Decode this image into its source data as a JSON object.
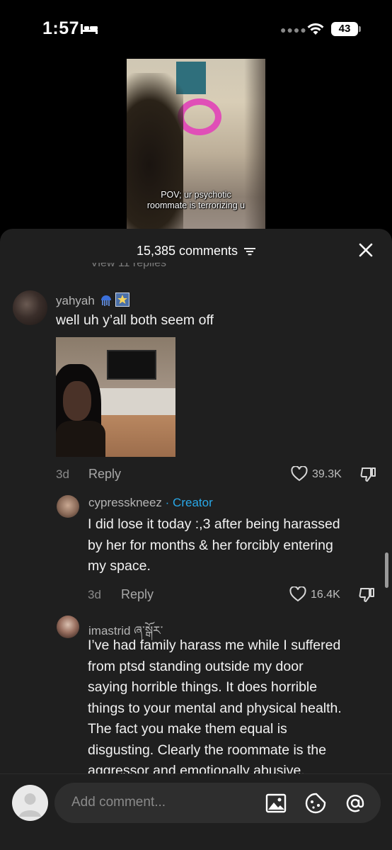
{
  "status_bar": {
    "time": "1:57",
    "battery": "43"
  },
  "video": {
    "caption_line1": "POV; ur psychotic",
    "caption_line2": "roommate is terrorizing u"
  },
  "comments_sheet": {
    "count_label": "15,385 comments",
    "cut_off_text": "View 11 replies",
    "comments": [
      {
        "username": "yahyah",
        "text": "well uh y’all both seem off",
        "age": "3d",
        "reply_label": "Reply",
        "likes": "39.3K"
      },
      {
        "username": "cypresskneez",
        "badge": " · Creator",
        "text_lines": [
          "I did lose it today :,3 after being harassed",
          "by her for months & her forcibly entering",
          "my space."
        ],
        "age": "3d",
        "reply_label": "Reply",
        "likes": "16.4K"
      },
      {
        "username": "imastrid ཞ་སྒོར་",
        "text_lines": [
          "I’ve had family harass me while I suffered",
          "from ptsd standing outside my door",
          "saying horrible things. It does horrible",
          "things to your mental and physical health.",
          "The fact you make them equal is",
          "disgusting. Clearly the roommate is the",
          "aggressor and emotionally abusive."
        ]
      }
    ]
  },
  "composer": {
    "placeholder": "Add comment..."
  },
  "colors": {
    "sheet_bg": "#1f1f1f",
    "creator_badge": "#29a8e8",
    "ring_pink": "#e04fb7"
  }
}
